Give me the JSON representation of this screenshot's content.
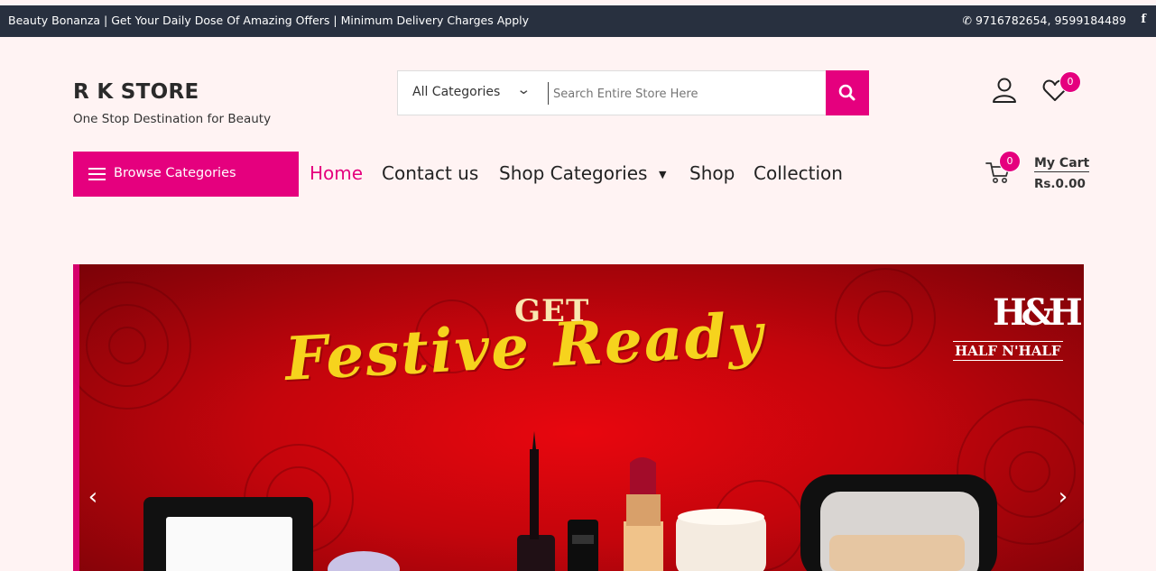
{
  "topbar": {
    "promo": "Beauty Bonanza | Get Your Daily Dose Of Amazing Offers | Minimum Delivery Charges Apply",
    "phone": "9716782654, 9599184489",
    "social": "f"
  },
  "store": {
    "name": "R K STORE",
    "tagline": "One Stop Destination for Beauty"
  },
  "search": {
    "category": "All Categories",
    "placeholder": "Search Entire Store Here"
  },
  "header_icons": {
    "wishlist_count": "0",
    "cart_count": "0"
  },
  "browse": {
    "label": "Browse Categories"
  },
  "nav": {
    "home": "Home",
    "contact": "Contact us",
    "shop_categories": "Shop Categories",
    "shop": "Shop",
    "collection": "Collection"
  },
  "cart": {
    "label": "My Cart",
    "total": "Rs.0.00"
  },
  "banner": {
    "line1": "GET",
    "line2": "Festive Ready",
    "brand_mark": "H&H",
    "brand_name": "HALF N'HALF"
  },
  "colors": {
    "accent": "#e5007e",
    "topbar": "#28303f",
    "page_bg": "#fff3f3"
  }
}
